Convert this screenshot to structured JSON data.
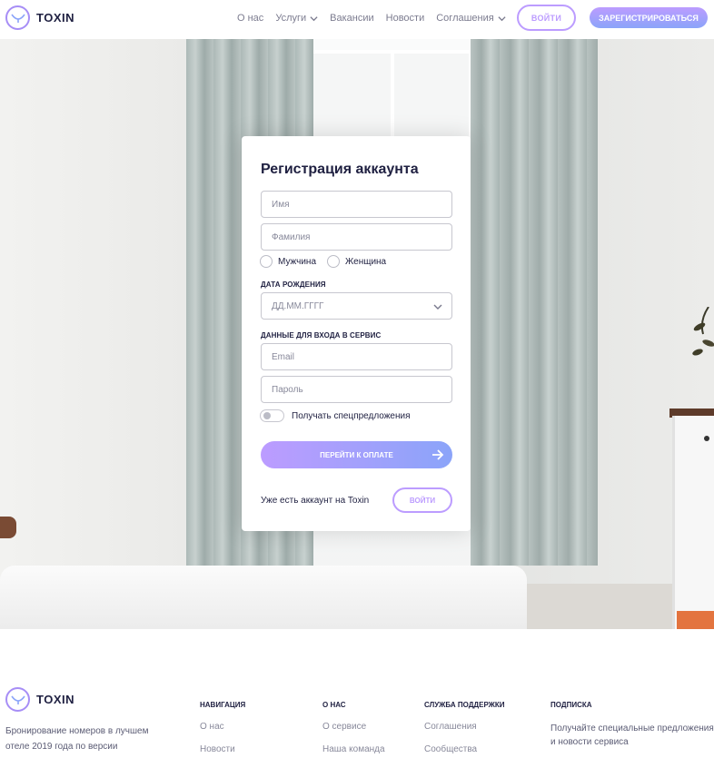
{
  "header": {
    "logo_text": "TOXIN",
    "nav": [
      {
        "label": "О нас",
        "has_dropdown": false
      },
      {
        "label": "Услуги",
        "has_dropdown": true
      },
      {
        "label": "Вакансии",
        "has_dropdown": false
      },
      {
        "label": "Новости",
        "has_dropdown": false
      },
      {
        "label": "Соглашения",
        "has_dropdown": true
      }
    ],
    "login_label": "ВОЙТИ",
    "register_label": "ЗАРЕГИСТРИРОВАТЬСЯ"
  },
  "form": {
    "title": "Регистрация аккаунта",
    "first_name_placeholder": "Имя",
    "last_name_placeholder": "Фамилия",
    "gender_options": [
      "Мужчина",
      "Женщина"
    ],
    "birthdate_label": "ДАТА РОЖДЕНИЯ",
    "birthdate_placeholder": "ДД.ММ.ГГГГ",
    "credentials_label": "ДАННЫЕ ДЛЯ ВХОДА В СЕРВИС",
    "email_placeholder": "Email",
    "password_placeholder": "Пароль",
    "offers_toggle_label": "Получать спецпредложения",
    "offers_toggle_on": false,
    "submit_label": "ПЕРЕЙТИ К ОПЛАТЕ",
    "have_account_text": "Уже есть аккаунт на Toxin",
    "login_button_label": "ВОЙТИ"
  },
  "footer": {
    "logo_text": "TOXIN",
    "description": "Бронирование номеров в лучшем отеле 2019 года по версии",
    "columns": [
      {
        "heading": "НАВИГАЦИЯ",
        "links": [
          "О нас",
          "Новости"
        ]
      },
      {
        "heading": "О НАС",
        "links": [
          "О сервисе",
          "Наша команда"
        ]
      },
      {
        "heading": "СЛУЖБА ПОДДЕРЖКИ",
        "links": [
          "Соглашения",
          "Сообщества"
        ]
      }
    ],
    "subscribe_heading": "ПОДПИСКА",
    "subscribe_text": "Получайте специальные предложения и новости сервиса"
  },
  "colors": {
    "accent": "#bc9cff",
    "accent_secondary": "#8ba4f9",
    "text_dark": "#1f2041"
  }
}
